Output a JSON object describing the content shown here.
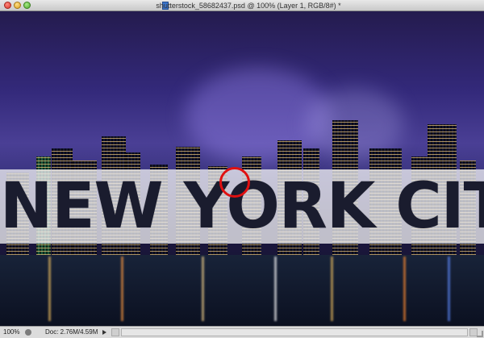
{
  "window": {
    "title": "shutterstock_58682437.psd @ 100% (Layer 1, RGB/8#) *"
  },
  "canvas": {
    "headline": "NEW YORK CITY"
  },
  "statusbar": {
    "zoom": "100%",
    "doc_size": "Doc: 2.76M/4.59M"
  },
  "colors": {
    "marker": "#e01010",
    "band": "#eeeef2"
  }
}
